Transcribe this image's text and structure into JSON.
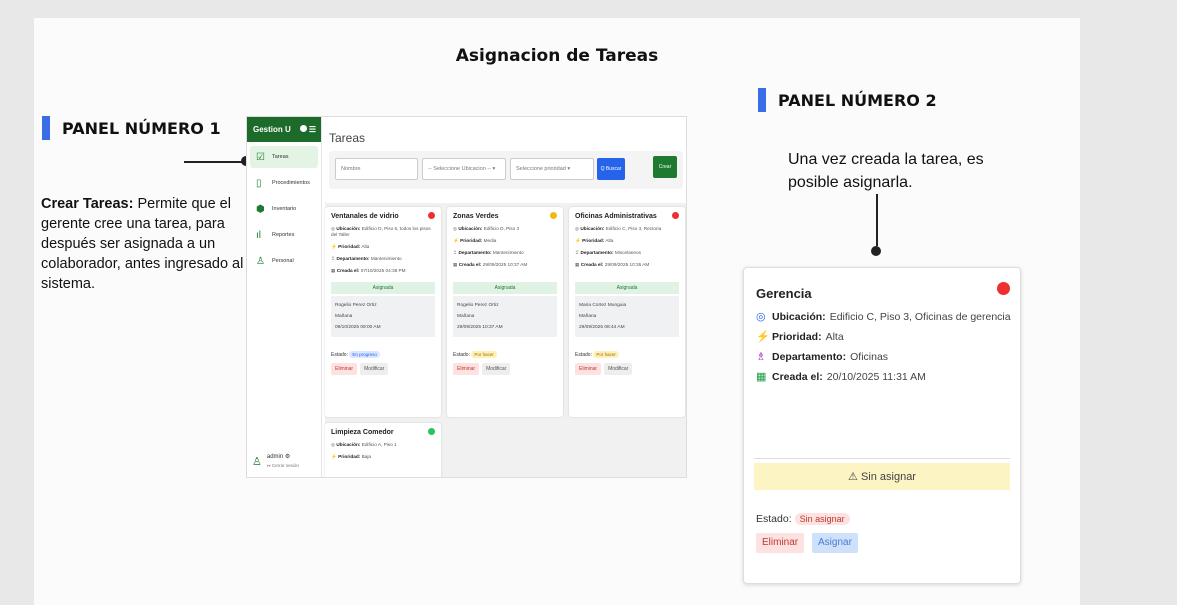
{
  "slide": {
    "title": "Asignacion de Tareas",
    "panel1_heading": "PANEL NÚMERO 1",
    "panel2_heading": "PANEL NÚMERO 2",
    "panel1_desc_bold": "Crear Tareas:",
    "panel1_desc_rest": " Permite que el gerente cree una tarea, para después ser asignada a un colaborador, antes ingresado al sistema.",
    "panel2_desc": "Una vez creada la tarea, es posible asignarla."
  },
  "app": {
    "brand": "Gestion U",
    "nav": [
      {
        "label": "Tareas",
        "icon": "check-square-icon"
      },
      {
        "label": "Procedimientos",
        "icon": "file-icon"
      },
      {
        "label": "Inventario",
        "icon": "box-icon"
      },
      {
        "label": "Reportes",
        "icon": "bar-chart-icon"
      },
      {
        "label": "Personal",
        "icon": "user-icon"
      }
    ],
    "user": "admin",
    "logout": "Cerrar sesión",
    "page_title": "Tareas",
    "filters": {
      "name_placeholder": "Nombre",
      "location": "-- Seleccione Ubicacion --",
      "priority": "Seleccione prioridad",
      "search": "Q Buscar",
      "create": "Crear"
    },
    "cards": [
      {
        "title": "Ventanales de vidrio",
        "ubicacion": "Edificio D, Piso 5, todos los pisos del Taller",
        "prioridad": "Alta",
        "departamento": "Mantenimiento",
        "creada": "07/10/2025 04:38 PM",
        "status": "Asignada",
        "person": "Rogelio Perez Ortiz",
        "turno": "Mañana",
        "fecha": "09/10/2025 09:00 AM",
        "estado": "En progreso",
        "color": "#ee2f2f"
      },
      {
        "title": "Zonas Verdes",
        "ubicacion": "Edificio D, Piso 3",
        "prioridad": "Media",
        "departamento": "Mantenimiento",
        "creada": "29/09/2025 10:37 AM",
        "status": "Asignada",
        "person": "Rogelio Perez Ortiz",
        "turno": "Mañana",
        "fecha": "29/09/2025 10:37 AM",
        "estado": "Por hacer",
        "color": "#f0b814"
      },
      {
        "title": "Oficinas Administrativas",
        "ubicacion": "Edificio C, Piso 3, Rectoria",
        "prioridad": "Alta",
        "departamento": "Miscelaneos",
        "creada": "29/09/2025 10:36 AM",
        "status": "Asignada",
        "person": "Maria Cortez Munguia",
        "turno": "Mañana",
        "fecha": "29/09/2025 08:44 AM",
        "estado": "Por hacer",
        "color": "#ee2f2f"
      },
      {
        "title": "Limpieza Comedor",
        "ubicacion": "Edificio A, Piso 1",
        "prioridad": "Baja",
        "color": "#22c55e"
      }
    ],
    "labels": {
      "ubicacion": "Ubicación:",
      "prioridad": "Prioridad:",
      "departamento": "Departamento:",
      "creada": "Creada el:",
      "estado": "Estado:",
      "eliminar": "Eliminar",
      "modificar": "Modificar"
    }
  },
  "big_card": {
    "title": "Gerencia",
    "ubicacion_label": "Ubicación:",
    "ubicacion": "Edificio C, Piso 3, Oficinas de gerencia",
    "prioridad_label": "Prioridad:",
    "prioridad": "Alta",
    "departamento_label": "Departamento:",
    "departamento": "Oficinas",
    "creada_label": "Creada el:",
    "creada": "20/10/2025 11:31 AM",
    "warning": "Sin asignar",
    "estado_label": "Estado:",
    "estado": "Sin asignar",
    "eliminar": "Eliminar",
    "asignar": "Asignar"
  }
}
